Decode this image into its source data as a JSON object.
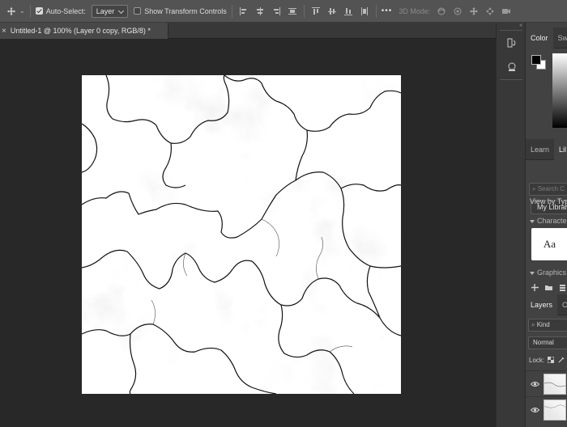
{
  "options_bar": {
    "auto_select_label": "Auto-Select:",
    "auto_select_checked": true,
    "auto_select_target": "Layer",
    "transform_controls_label": "Show Transform Controls",
    "transform_controls_checked": false,
    "more_label": "•••",
    "mode_3d_label": "3D Mode:"
  },
  "document_tab": {
    "close_glyph": "×",
    "title": "Untitled-1 @ 100% (Layer 0 copy, RGB/8) *"
  },
  "panel_strip": {
    "collapse_glyph": "«"
  },
  "color_panel": {
    "tabs": [
      "Color",
      "Sw"
    ],
    "foreground": "#000000",
    "background": "#ffffff"
  },
  "libraries_panel": {
    "tabs": [
      "Learn",
      "Lil"
    ],
    "search_placeholder": "Search C",
    "library_select": "My Library",
    "view_by": "View by Type",
    "characters_header": "Character",
    "character_sample": "Aa",
    "graphics_header": "Graphics"
  },
  "layers_panel": {
    "tabs": [
      "Layers",
      "C"
    ],
    "kind_label": "Kind",
    "blend_mode": "Normal",
    "lock_label": "Lock:"
  },
  "colors": {
    "options_bar": "#535353",
    "canvas_bg": "#282828",
    "panel_bg": "#424242"
  }
}
